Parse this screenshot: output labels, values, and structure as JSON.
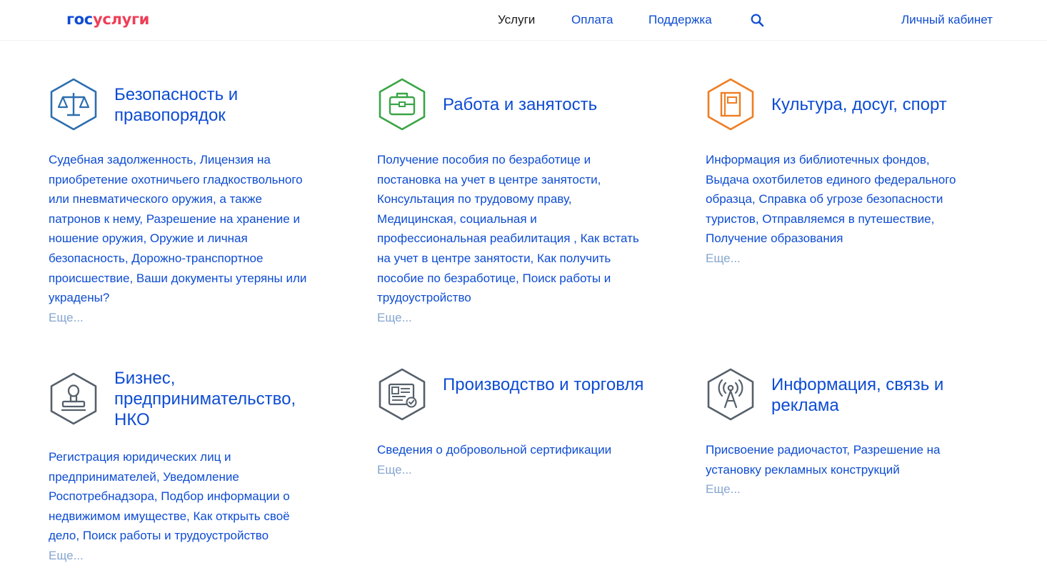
{
  "header": {
    "logo_part1": "гос",
    "logo_part2": "услуги",
    "nav": [
      {
        "label": "Услуги"
      },
      {
        "label": "Оплата"
      },
      {
        "label": "Поддержка"
      }
    ],
    "search_icon": "search-icon",
    "cabinet_label": "Личный кабинет"
  },
  "colors": {
    "brand_blue": "#0d4cd3",
    "brand_red": "#ee3f58",
    "icon_blue": "#2d6eaf",
    "icon_green": "#3aa546",
    "icon_orange": "#ef7d22",
    "icon_gray": "#55606b",
    "more_link": "#86a6cf"
  },
  "categories": [
    {
      "icon": "scales-icon",
      "title": "Безопасность и правопорядок",
      "links": "Судебная задолженность, Лицензия на приобретение охотничьего гладкоствольного или пневматического оружия, а также патронов к нему, Разрешение на хранение и ношение оружия, Оружие и личная безопасность, Дорожно-транспортное происшествие, Ваши документы утеряны или украдены?",
      "more": "Еще..."
    },
    {
      "icon": "briefcase-icon",
      "title": "Работа и занятость",
      "links": "Получение пособия по безработице и постановка на учет в центре занятости, Консультация по трудовому праву, Медицинская, социальная и профессиональная реабилитация , Как встать на учет в центре занятости, Как получить пособие по безработице, Поиск работы и трудоустройство",
      "more": "Еще..."
    },
    {
      "icon": "book-icon",
      "title": "Культура, досуг, спорт",
      "links": "Информация из библиотечных фондов, Выдача охотбилетов единого федерального образца, Справка об угрозе безопасности туристов, Отправляемся в путешествие, Получение образования",
      "more": "Еще..."
    },
    {
      "icon": "stamp-icon",
      "title": "Бизнес, предпринимательство, НКО",
      "links": "Регистрация юридических лиц и предпринимателей, Уведомление Роспотребнадзора, Подбор информации о недвижимом имуществе, Как открыть своё дело, Поиск работы и трудоустройство",
      "more": "Еще..."
    },
    {
      "icon": "certificate-icon",
      "title": "Производство и торговля",
      "links": "Сведения о добровольной сертификации",
      "more": "Еще..."
    },
    {
      "icon": "antenna-icon",
      "title": "Информация, связь и реклама",
      "links": "Присвоение радиочастот, Разрешение на установку рекламных конструкций",
      "more": "Еще..."
    }
  ]
}
